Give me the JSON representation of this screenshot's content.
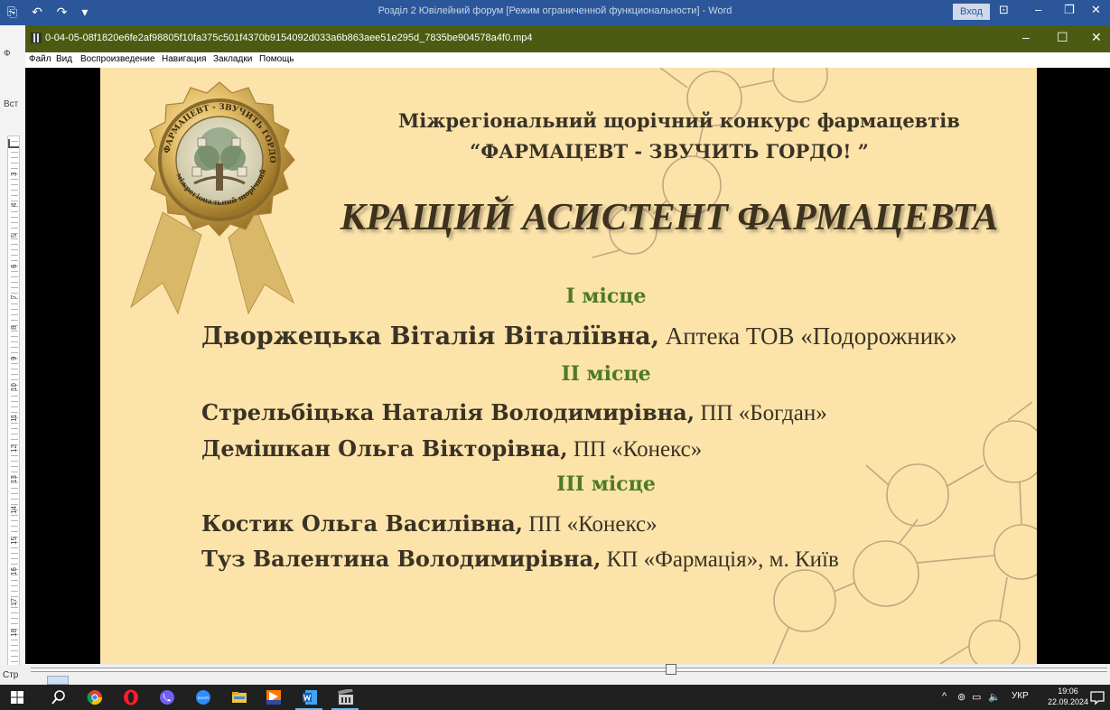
{
  "word": {
    "title": "Розділ 2 Ювілейний форум [Режим ограниченной функциональности]  -  Word",
    "signin": "Вход",
    "side_letter_top": "Ф",
    "side_letter_mid": "Вст",
    "status_left": "Стр",
    "ruler_numbers": [
      "3",
      "4",
      "5",
      "6",
      "7",
      "8",
      "9",
      "10",
      "11",
      "12",
      "13",
      "14",
      "15",
      "16",
      "17",
      "18"
    ]
  },
  "player": {
    "title": "0-04-05-08f1820e6fe2af98805f10fa375c501f4370b9154092d033a6b863aee51e295d_7835be904578a4f0.mp4",
    "menu": [
      "Файл",
      "Вид",
      "Воспроизведение",
      "Навигация",
      "Закладки",
      "Помощь"
    ],
    "controls": {
      "minimize": "–",
      "maximize": "☐",
      "close": "✕"
    }
  },
  "slide": {
    "contest_line1": "Міжрегіональний щорічний  конкурс фармацевтів",
    "contest_line2": "“ФАРМАЦЕВТ - ЗВУЧИТЬ ГОРДО! ”",
    "title": "КРАЩИЙ АСИСТЕНТ ФАРМАЦЕВТА",
    "medal_text": "ФАРМАЦЕВТ - ЗВУЧИТЬ ГОРДО! міжрегіональний щорічний конкурс",
    "places": [
      {
        "label": "І місце",
        "winners": [
          {
            "name": "Дворжецька Віталія Віталіївна,",
            "org": " Аптека ТОВ «Подорожник»"
          }
        ]
      },
      {
        "label": "ІІ місце",
        "winners": [
          {
            "name": "Стрельбіцька Наталія Володимирівна,",
            "org": " ПП «Богдан»"
          },
          {
            "name": "Демішкан Ольга Вікторівна,",
            "org": " ПП «Конекс»"
          }
        ]
      },
      {
        "label": "ІІІ місце",
        "winners": [
          {
            "name": "Костик Ольга Василівна,",
            "org": " ПП «Конекс»"
          },
          {
            "name": "Туз Валентина Володимирівна,",
            "org": " КП «Фармація», м. Київ"
          }
        ]
      }
    ],
    "colors": {
      "background": "#fce3aa",
      "place": "#4e7a28",
      "text": "#3a3325",
      "molecule": "#b9a27c"
    }
  },
  "taskbar": {
    "icons": [
      "windows-start-icon",
      "search-icon",
      "chrome-icon",
      "opera-icon",
      "viber-icon",
      "zoom-icon",
      "file-explorer-icon",
      "filmora-icon",
      "word-icon",
      "video-player-icon"
    ],
    "zoom_label": "zoom",
    "language": "УКР",
    "time": "19:06",
    "date": "22.09.2024"
  }
}
